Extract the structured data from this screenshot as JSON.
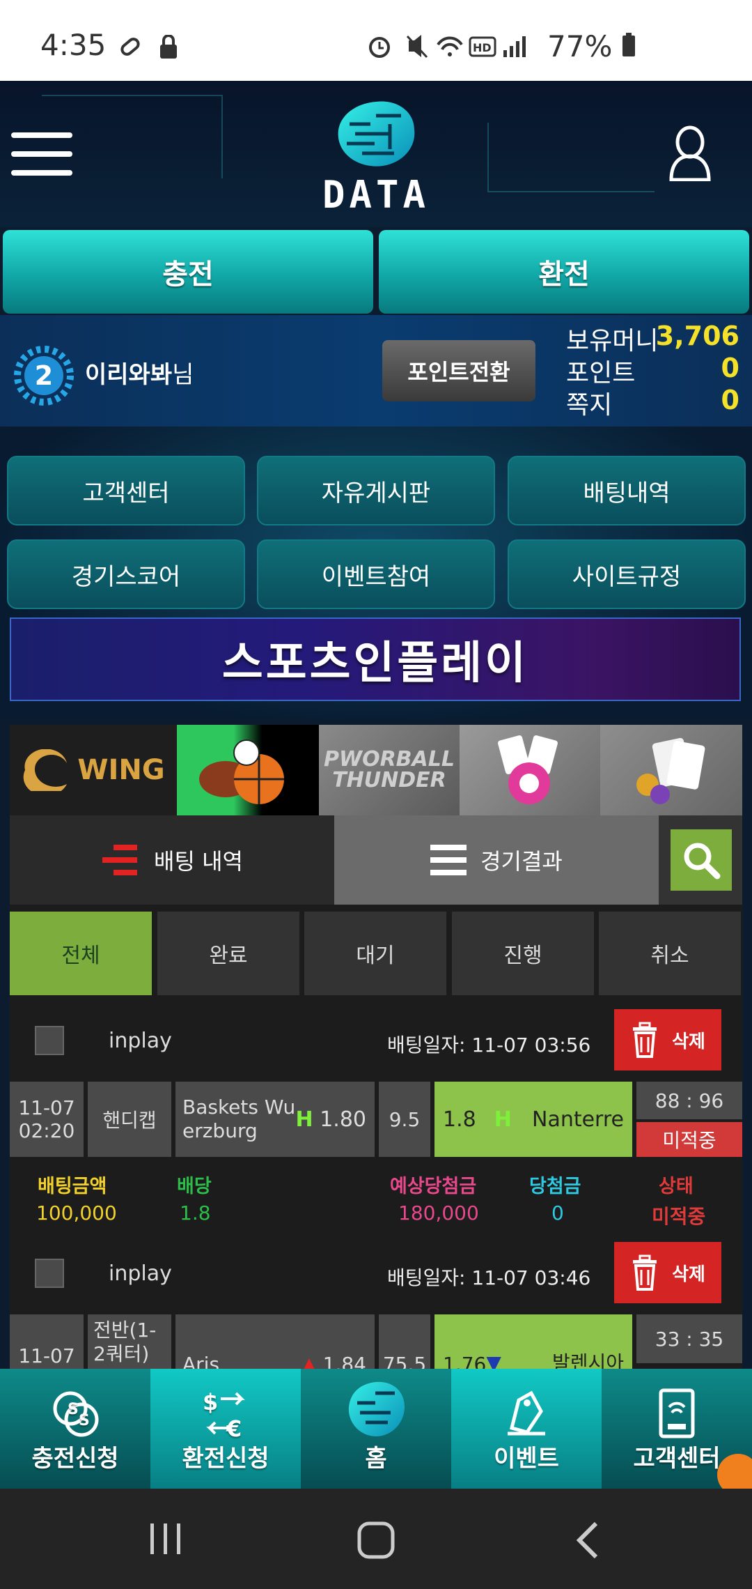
{
  "status": {
    "time": "4:35",
    "battery": "77%"
  },
  "app": {
    "logo_text": "DATA"
  },
  "actions": {
    "charge": "충전",
    "exchange": "환전"
  },
  "user": {
    "level": "2",
    "name": "이리와봐",
    "suffix": "님",
    "point_convert": "포인트전환"
  },
  "stats": [
    {
      "label": "보유머니",
      "value": "3,706"
    },
    {
      "label": "포인트",
      "value": "0"
    },
    {
      "label": "쪽지",
      "value": "0"
    }
  ],
  "menu": [
    "고객센터",
    "자유게시판",
    "배팅내역",
    "경기스코어",
    "이벤트참여",
    "사이트규정"
  ],
  "banner": "스포츠인플레이",
  "games": [
    {
      "name": "WING"
    },
    {
      "name": "sports-balls"
    },
    {
      "name": "PWORBALL THUNDER"
    },
    {
      "name": "casino-chips"
    },
    {
      "name": "card-chips"
    }
  ],
  "tabs": {
    "bet_history": "배팅 내역",
    "results": "경기결과"
  },
  "filters": [
    "전체",
    "완료",
    "대기",
    "진행",
    "취소"
  ],
  "bets": [
    {
      "type": "inplay",
      "date_label": "배팅일자: 11-07 03:56",
      "delete": "삭제",
      "time1": "11-07",
      "time2": "02:20",
      "market": "핸디캡",
      "home": "Baskets Wu erzburg",
      "home_a": "Baskets Wu",
      "home_b": "erzburg",
      "home_mark": "H",
      "home_odds": "1.80",
      "line": "9.5",
      "away_odds": "1.8",
      "away_mark": "H",
      "away": "Nanterre",
      "score": "88 : 96",
      "state": "미적중"
    },
    {
      "type": "inplay",
      "date_label": "배팅일자: 11-07 03:46",
      "delete": "삭제",
      "time1": "11-07",
      "market": "전반(1-2쿼터)",
      "market_a": "전반(1-",
      "market_b": "2쿼터)",
      "home": "Aris",
      "home_odds": "1.84",
      "line": "75.5",
      "away_odds": "1.76",
      "away": "발렌시아",
      "score": "33 : 35"
    }
  ],
  "summary": {
    "labels": [
      "배팅금액",
      "배당",
      "예상당첨금",
      "당첨금",
      "상태"
    ],
    "values": [
      "100,000",
      "1.8",
      "180,000",
      "0",
      "미적중"
    ]
  },
  "bottom_nav": [
    "충전신청",
    "환전신청",
    "홈",
    "이벤트",
    "고객센터"
  ],
  "colors": {
    "accent": "#11a7a6",
    "gold": "#f6e12a",
    "green": "#8dc34a",
    "red": "#d42424"
  }
}
